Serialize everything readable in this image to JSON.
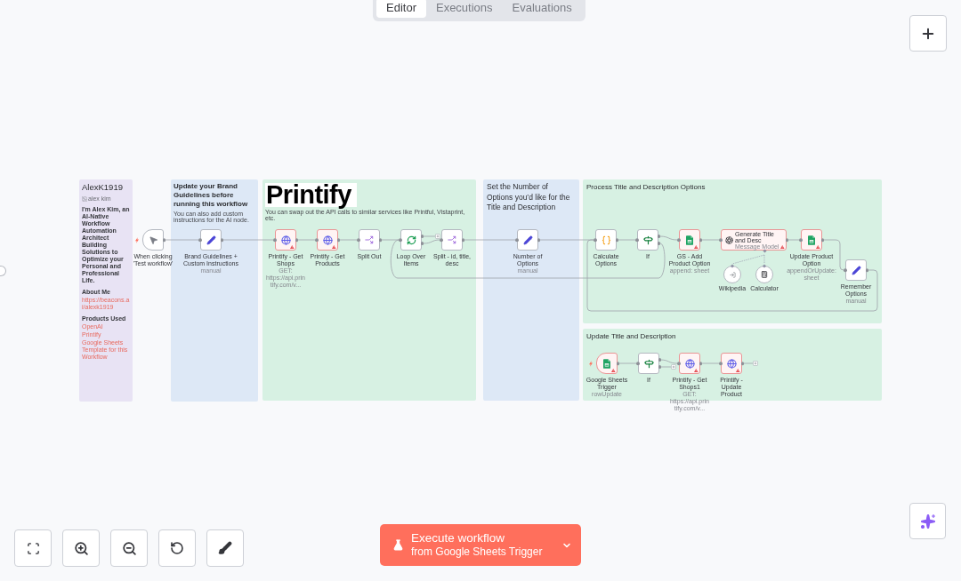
{
  "tabs": [
    {
      "label": "Editor",
      "selected": true
    },
    {
      "label": "Executions",
      "selected": false
    },
    {
      "label": "Evaluations",
      "selected": false
    }
  ],
  "canvas": {
    "sticky_notes": [
      {
        "color": "#e8e3f4",
        "title": "AlexK1919",
        "blocks": [
          {
            "kind": "image",
            "text": "alex kim"
          },
          {
            "kind": "paragraph",
            "text": "I'm Alex Kim, an AI-Native Workflow Automation Architect Building Solutions to Optimize your Personal and Professional Life."
          },
          {
            "kind": "heading",
            "text": "About Me"
          },
          {
            "kind": "link",
            "text": "https://beacons.ai/alexk1919"
          },
          {
            "kind": "heading",
            "text": "Products Used"
          },
          {
            "kind": "link",
            "text": "OpenAI"
          },
          {
            "kind": "link",
            "text": "Printify"
          },
          {
            "kind": "link",
            "text": "Google Sheets Template for this Workflow"
          }
        ]
      },
      {
        "color": "#dde8f6",
        "title": "Update your Brand Guidelines before running this workflow",
        "blocks": [
          {
            "kind": "note",
            "text": "You can also add custom instructions for the AI node."
          }
        ]
      },
      {
        "color": "#d7f1e3",
        "blocks": [
          {
            "kind": "logo",
            "text": "Printify"
          },
          {
            "kind": "note",
            "text": "You can swap out the API calls to similar services like Printful, Vistaprint, etc."
          }
        ]
      },
      {
        "color": "#dde8f6",
        "title": "Set the Number of Options you’d like for the Title and Description"
      },
      {
        "color": "#d7f1e3",
        "title": "Process Title and Description Options"
      },
      {
        "color": "#d7f1e3",
        "title": "Update Title and Description"
      }
    ],
    "nodes": [
      {
        "kind": "manual-trigger",
        "label": "When clicking 'Test workflow'",
        "error": false
      },
      {
        "kind": "set",
        "label": "Brand Guidelines + Custom Instructions",
        "subtitle": "manual",
        "error": false
      },
      {
        "kind": "http",
        "label": "Printify - Get Shops",
        "subtitle": "GET: https://api.printify.com/v...",
        "error": true
      },
      {
        "kind": "http",
        "label": "Printify - Get Products",
        "error": true
      },
      {
        "kind": "split",
        "label": "Split Out",
        "error": false
      },
      {
        "kind": "loop",
        "label": "Loop Over Items",
        "error": false
      },
      {
        "kind": "split",
        "label": "Split - id, title, desc",
        "error": false
      },
      {
        "kind": "set",
        "label": "Number of Options",
        "subtitle": "manual",
        "error": false
      },
      {
        "kind": "code",
        "label": "Calculate Options",
        "error": false
      },
      {
        "kind": "if",
        "label": "If",
        "error": false
      },
      {
        "kind": "sheets",
        "label": "GS - Add Product Option",
        "subtitle": "append: sheet",
        "error": true
      },
      {
        "kind": "agent",
        "label": "Generate Title and Desc",
        "subtitle": "Message Model",
        "error": true
      },
      {
        "kind": "sheets",
        "label": "Update Product Option",
        "subtitle": "appendOrUpdate: sheet",
        "error": true
      },
      {
        "kind": "tool-wikipedia",
        "label": "Wikipedia",
        "error": false
      },
      {
        "kind": "tool-calculator",
        "label": "Calculator",
        "error": false
      },
      {
        "kind": "set",
        "label": "Remember Options",
        "subtitle": "manual",
        "error": false
      },
      {
        "kind": "sheets-trigger",
        "label": "Google Sheets Trigger",
        "subtitle": "rowUpdate",
        "error": true
      },
      {
        "kind": "if",
        "label": "If",
        "error": false
      },
      {
        "kind": "http",
        "label": "Printify - Get Shops1",
        "subtitle": "GET: https://api.printify.com/v...",
        "error": true
      },
      {
        "kind": "http",
        "label": "Printify - Update Product",
        "error": true
      }
    ]
  },
  "execute_button": {
    "label": "Execute workflow",
    "sublabel": "from Google Sheets Trigger"
  }
}
